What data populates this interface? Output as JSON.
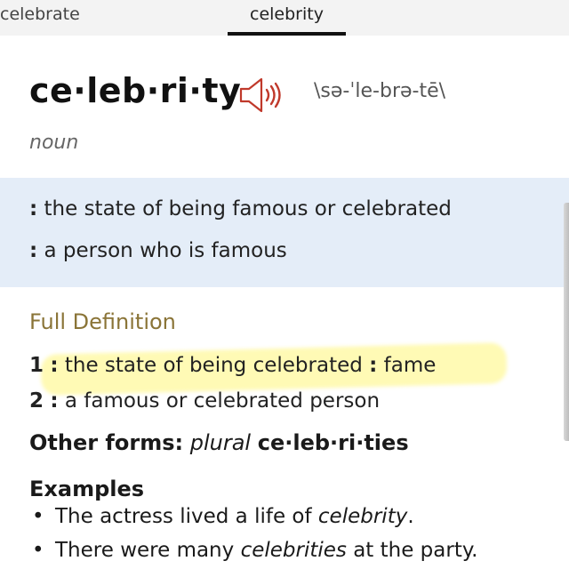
{
  "tabs": {
    "previous": "celebrate",
    "current": "celebrity"
  },
  "entry": {
    "headword": "ce·leb·ri·ty",
    "pronunciation": "\\sə-ˈle-brə-tē\\",
    "part_of_speech": "noun",
    "speaker_icon": "speaker-audio-icon"
  },
  "short_definitions": [
    {
      "marker": ":",
      "text": "the state of being famous or celebrated"
    },
    {
      "marker": ":",
      "text": "a person who is famous"
    }
  ],
  "full_definition": {
    "title": "Full Definition",
    "senses": [
      {
        "number": "1",
        "marker": ":",
        "text": "the state of being celebrated",
        "synonym_marker": ":",
        "synonym": "fame"
      },
      {
        "number": "2",
        "marker": ":",
        "text": "a famous or celebrated person"
      }
    ]
  },
  "other_forms": {
    "label": "Other forms:",
    "qualifier": "plural",
    "form": "ce·leb·ri·ties"
  },
  "examples": {
    "title": "Examples",
    "items": [
      {
        "before": "The actress lived a life of ",
        "term": "celebrity",
        "after": "."
      },
      {
        "before": "There were many ",
        "term": "celebrities",
        "after": " at the party."
      }
    ]
  },
  "colors": {
    "section_title": "#8a7437",
    "definition_band": "#e4edf8",
    "highlight": "#fff678",
    "speaker": "#c0392b"
  }
}
